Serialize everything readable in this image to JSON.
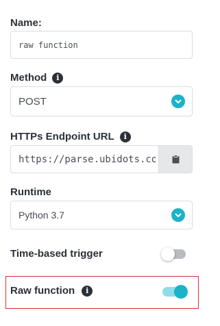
{
  "name": {
    "label": "Name:",
    "value": "raw function"
  },
  "method": {
    "label": "Method",
    "selected": "POST",
    "info_icon": "info-icon",
    "chevron_icon": "chevron-down-icon"
  },
  "endpoint": {
    "label": "HTTPs Endpoint URL",
    "value": "https://parse.ubidots.co",
    "info_icon": "info-icon",
    "copy_icon": "clipboard-icon"
  },
  "runtime": {
    "label": "Runtime",
    "selected": "Python 3.7",
    "chevron_icon": "chevron-down-icon"
  },
  "time_trigger": {
    "label": "Time-based trigger",
    "enabled": false
  },
  "raw_function": {
    "label": "Raw function",
    "info_icon": "info-icon",
    "enabled": true
  },
  "colors": {
    "accent": "#1ab3c8",
    "toggle_track_on": "#8fdde7",
    "toggle_track_off": "#b9bcc1",
    "highlight_border": "#d32f2f",
    "label_text": "#2b3038"
  }
}
